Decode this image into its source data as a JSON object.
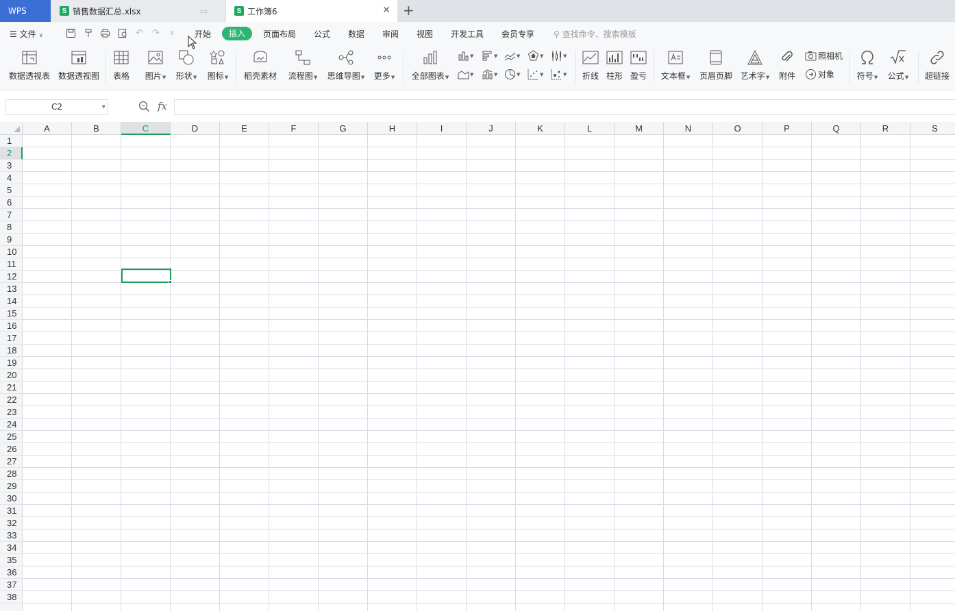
{
  "tabs": {
    "wps": "WPS",
    "file1": "销售数据汇总.xlsx",
    "file2": "工作簿6"
  },
  "menu": {
    "file": "文件",
    "items": [
      "开始",
      "插入",
      "页面布局",
      "公式",
      "数据",
      "审阅",
      "视图",
      "开发工具",
      "会员专享"
    ],
    "search": "查找命令、搜索模板"
  },
  "ribbon": {
    "pivot_table": "数据透视表",
    "pivot_chart": "数据透视图",
    "table": "表格",
    "picture": "图片",
    "shape": "形状",
    "icon": "图标",
    "materials": "稻壳素材",
    "flowchart": "流程图",
    "mindmap": "思维导图",
    "more": "更多",
    "all_charts": "全部图表",
    "sparkline_line": "折线",
    "sparkline_column": "柱形",
    "sparkline_winloss": "盈亏",
    "textbox": "文本框",
    "header_footer": "页眉页脚",
    "wordart": "艺术字",
    "attachment": "附件",
    "camera": "照相机",
    "object": "对象",
    "symbol": "符号",
    "formula": "公式",
    "hyperlink": "超链接"
  },
  "formula_bar": {
    "name_box": "C2",
    "fx": "fx",
    "content": ""
  },
  "grid": {
    "columns": [
      "A",
      "B",
      "C",
      "D",
      "E",
      "F",
      "G",
      "H",
      "I",
      "J",
      "K",
      "L",
      "M",
      "N",
      "O",
      "P",
      "Q",
      "R",
      "S"
    ],
    "rows": [
      "1",
      "2",
      "3",
      "4",
      "5",
      "6",
      "7",
      "8",
      "9",
      "10",
      "11",
      "12",
      "13",
      "14",
      "15",
      "16",
      "17",
      "18",
      "19",
      "20",
      "21",
      "22",
      "23",
      "24",
      "25",
      "26",
      "27",
      "28",
      "29",
      "30",
      "31",
      "32",
      "33",
      "34",
      "35",
      "36",
      "37",
      "38"
    ],
    "active_column": "C",
    "active_row": "2"
  },
  "colors": {
    "accent": "#2bb673",
    "selection": "#1e9c5a",
    "wps_tab": "#3b6fd6"
  }
}
